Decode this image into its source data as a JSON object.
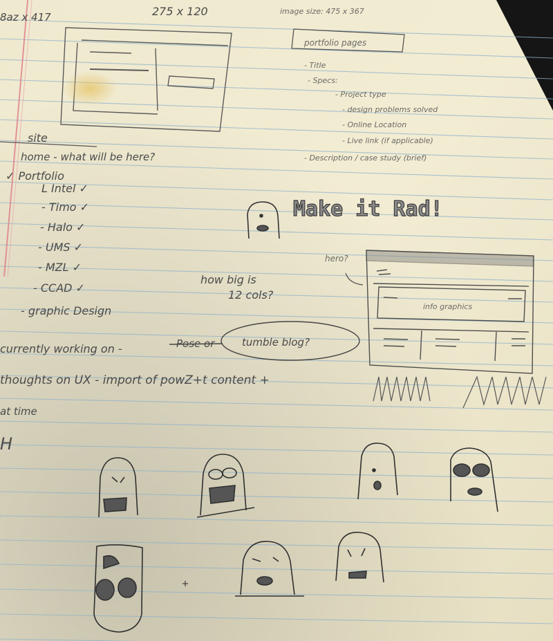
{
  "notes": {
    "top_left_scrawl": "8az x 417",
    "top_dimensions": "275 x 120",
    "top_image_size": "image size: 475 x 367",
    "portfolio_heading": "portfolio pages",
    "portfolio_items": [
      "- Title",
      "- Specs:",
      "- Project type",
      "- design problems solved",
      "- Online Location",
      "- Live link (if applicable)",
      "- Description / case study (brief)"
    ],
    "site_heading": "site",
    "home_line": "home - what will be here?",
    "portfolio_check": "✓ Portfolio",
    "portfolio_sublist": [
      "L Intel ✓",
      "- Timo ✓",
      "- Halo ✓",
      "- UMS ✓",
      "- MZL ✓",
      "- CCAD ✓",
      "- graphic Design"
    ],
    "make_it_rad": "Make it Rad!",
    "how_big": [
      "how big is",
      "12 cols?"
    ],
    "hero_label": "hero?",
    "hero_inner": "info graphics",
    "currently": "currently working on -",
    "struck": "Pose or",
    "circled": "tumble blog?",
    "thoughts": "thoughts on UX - import of powZ+t content +",
    "time_line": "at time",
    "margin_letter": "H"
  }
}
